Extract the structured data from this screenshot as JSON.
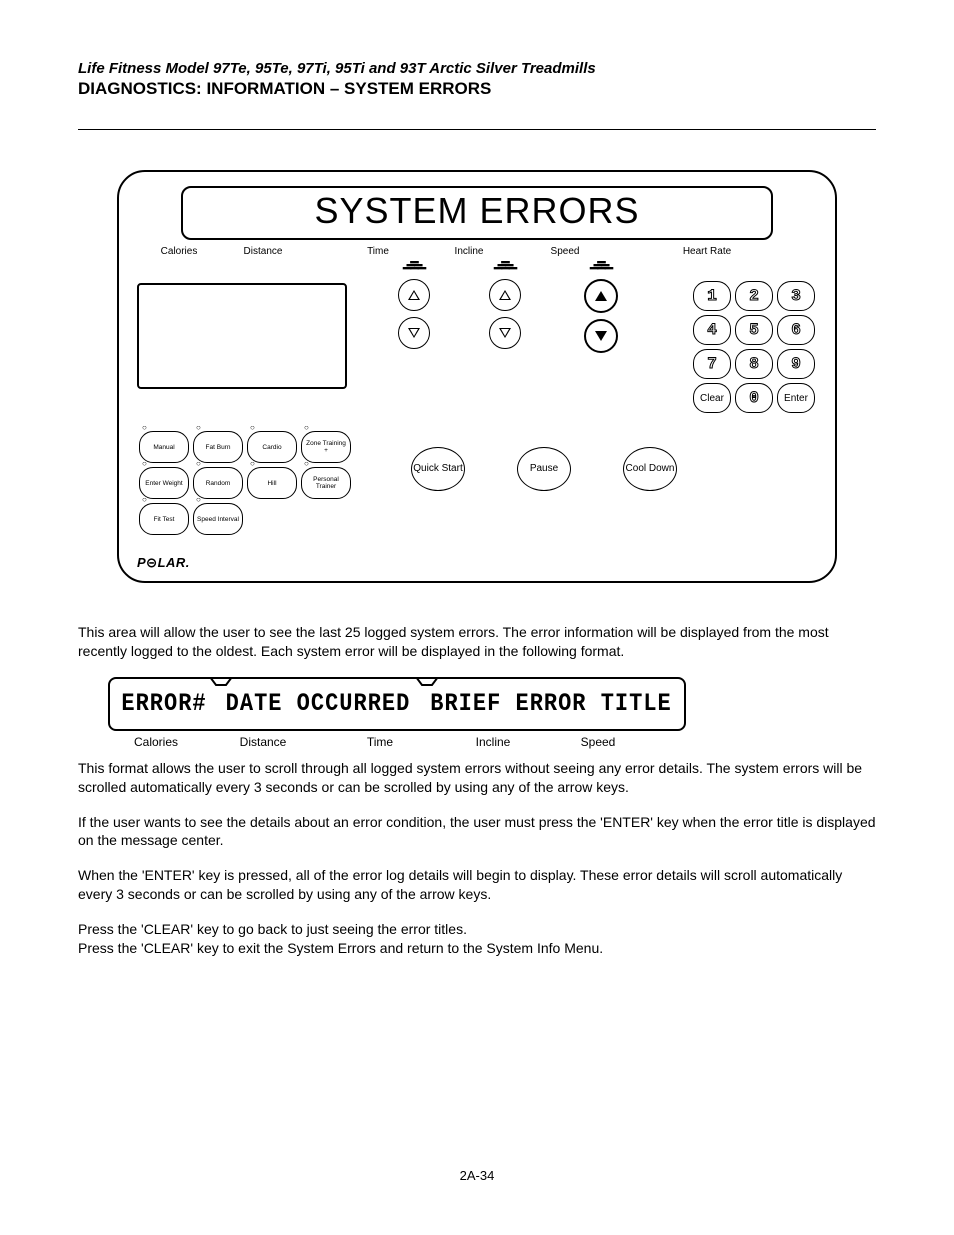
{
  "header": {
    "model_line": "Life Fitness Model 97Te, 95Te, 97Ti, 95Ti and 93T Arctic Silver Treadmills",
    "section_title": "DIAGNOSTICS: INFORMATION – SYSTEM ERRORS"
  },
  "console": {
    "title": "SYSTEM ERRORS",
    "columns": {
      "calories": "Calories",
      "distance": "Distance",
      "time": "Time",
      "incline": "Incline",
      "speed": "Speed",
      "heart_rate": "Heart Rate"
    },
    "keypad": {
      "keys": [
        [
          "1",
          "2",
          "3"
        ],
        [
          "4",
          "5",
          "6"
        ],
        [
          "7",
          "8",
          "9"
        ],
        [
          "Clear",
          "0",
          "Enter"
        ]
      ]
    },
    "programs_row1": [
      "Manual",
      "Fat Burn",
      "Cardio",
      "Zone Training +",
      "Enter Weight"
    ],
    "programs_row2": [
      "Random",
      "Hill",
      "Personal Trainer",
      "Fit Test",
      "Speed Interval"
    ],
    "actions": {
      "quick_start": "Quick Start",
      "pause": "Pause",
      "cool_down": "Cool Down"
    },
    "brand": "POLAR."
  },
  "paragraphs": {
    "p1": "This area will allow the user to see the last 25 logged system errors. The error information will be displayed from the most recently logged to the oldest. Each system error will be displayed in the following format.",
    "p2": "This format allows the user to scroll through all logged system errors without seeing any error details. The system errors will be scrolled automatically every 3 seconds or can be scrolled by using any of the arrow keys.",
    "p3": "If the user wants to see the details about an error condition, the user must press the 'ENTER' key when the error title is displayed on the message center.",
    "p4": "When the 'ENTER' key is pressed, all of the error log details will begin to display. These error details will scroll automatically every 3 seconds or can be scrolled by using any of the arrow keys.",
    "p5a": "Press the 'CLEAR' key to go back to just seeing the error titles.",
    "p5b": "Press the 'CLEAR' key to exit the System Errors and return to the System Info Menu."
  },
  "strip": {
    "cell1": "ERROR#",
    "cell2": "DATE OCCURRED",
    "cell3": "BRIEF ERROR TITLE",
    "labels": {
      "calories": "Calories",
      "distance": "Distance",
      "time": "Time",
      "incline": "Incline",
      "speed": "Speed"
    }
  },
  "page_number": "2A-34"
}
